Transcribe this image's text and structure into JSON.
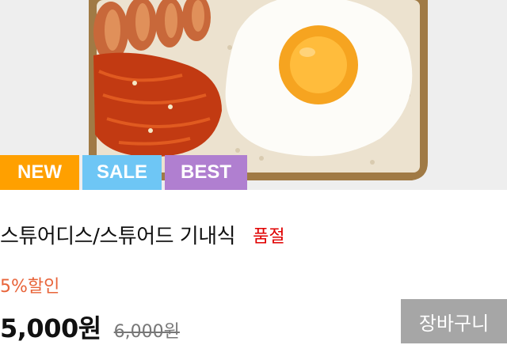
{
  "product": {
    "title": "스튜어디스/스튜어드 기내식",
    "soldout_label": "품절",
    "discount_label": "5%할인",
    "price": "5,000원",
    "original_price": "6,000원",
    "image_icon": "meal-tray-image"
  },
  "badges": [
    {
      "label": "NEW",
      "color": "#ffa000"
    },
    {
      "label": "SALE",
      "color": "#6ec6f5"
    },
    {
      "label": "BEST",
      "color": "#b07fd0"
    }
  ],
  "cart_button": {
    "label": "장바구니"
  },
  "colors": {
    "soldout": "#e00000",
    "discount": "#e8643a",
    "cart_button_bg": "#a6a6a6"
  }
}
